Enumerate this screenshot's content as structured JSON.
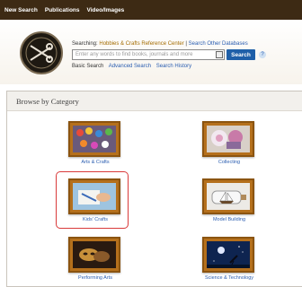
{
  "nav": {
    "items": [
      "New Search",
      "Publications",
      "Video/Images"
    ]
  },
  "search": {
    "searching_prefix": "Searching:",
    "database_name": "Hobbies & Crafts Reference Center",
    "separator": "|",
    "other_databases": "Search Other Databases",
    "placeholder": "Enter any words to find books, journals and more",
    "button_label": "Search",
    "help_label": "?",
    "basic_label": "Basic Search",
    "advanced_label": "Advanced Search",
    "history_label": "Search History"
  },
  "browse": {
    "heading": "Browse by Category",
    "categories": [
      {
        "label": "Arts & Crafts",
        "icon": "paint-palette-icon"
      },
      {
        "label": "Collecting",
        "icon": "collectibles-icon"
      },
      {
        "label": "Kids' Crafts",
        "icon": "kids-crafts-icon"
      },
      {
        "label": "Model Building",
        "icon": "ship-in-bottle-icon"
      },
      {
        "label": "Performing Arts",
        "icon": "theatre-masks-icon"
      },
      {
        "label": "Science & Technology",
        "icon": "telescope-icon"
      }
    ]
  },
  "colors": {
    "nav_bg": "#3d2a14",
    "frame": "#b5701c",
    "link": "#2a5db0",
    "button": "#1f5fa8",
    "highlight": "#d93a3a"
  }
}
